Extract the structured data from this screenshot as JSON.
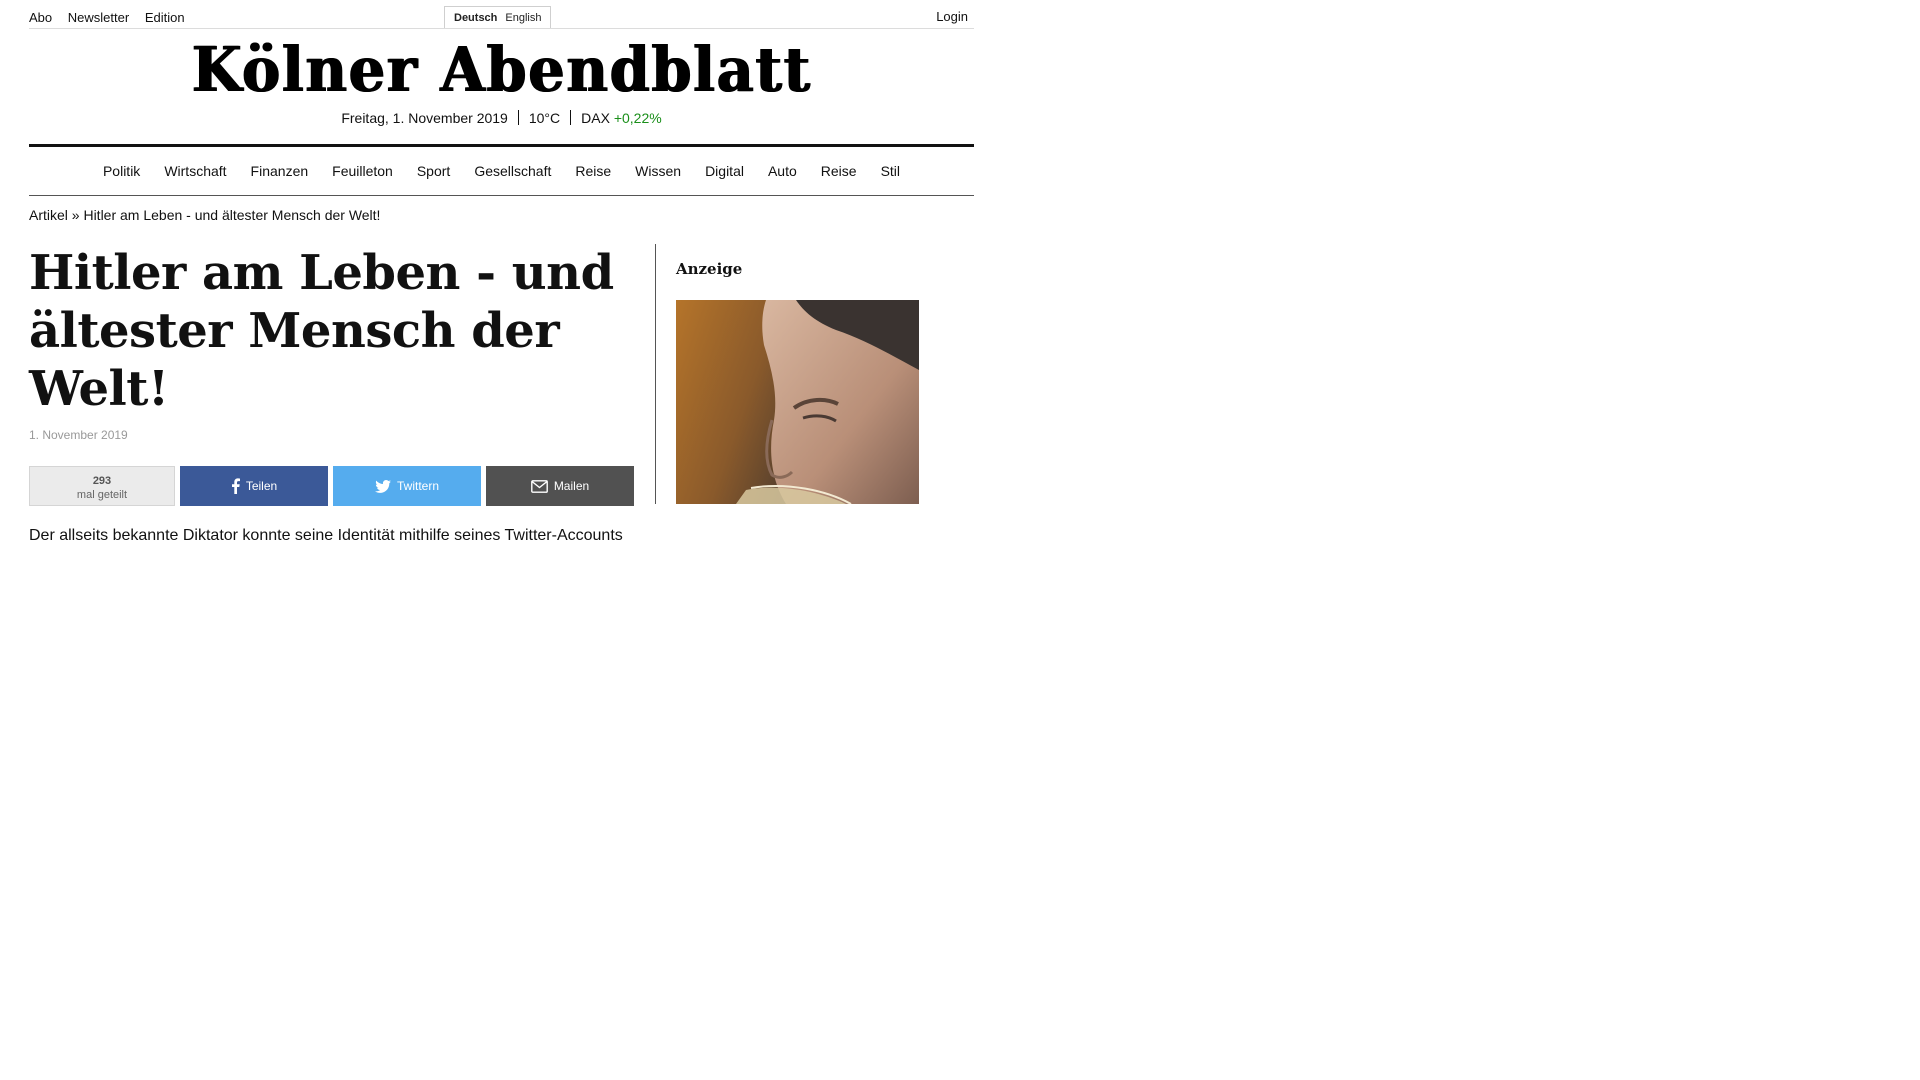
{
  "topbar": {
    "links": [
      "Abo",
      "Newsletter",
      "Edition"
    ],
    "languages": [
      "Deutsch",
      "English"
    ],
    "active_language": "Deutsch",
    "login": "Login"
  },
  "masthead": {
    "logo": "Kölner Abendblatt",
    "date": "Freitag, 1. November 2019",
    "temperature": "10°C",
    "dax_label": "DAX",
    "dax_change": "+0,22%"
  },
  "colors": {
    "dax_positive": "#1a8f1a",
    "facebook": "#3b5998",
    "twitter": "#55acee",
    "mail": "#515151"
  },
  "nav": {
    "items": [
      "Politik",
      "Wirtschaft",
      "Finanzen",
      "Feuilleton",
      "Sport",
      "Gesellschaft",
      "Reise",
      "Wissen",
      "Digital",
      "Auto",
      "Reise",
      "Stil"
    ]
  },
  "breadcrumb": "Artikel » Hitler am Leben - und ältester Mensch der Welt!",
  "article": {
    "headline": "Hitler am Leben - und ältester Mensch der Welt!",
    "date": "1. November 2019",
    "share": {
      "count": "293",
      "count_label": "mal geteilt",
      "facebook": "Teilen",
      "twitter": "Twittern",
      "mail": "Mailen"
    },
    "lead": "Der allseits bekannte Diktator konnte seine Identität mithilfe seines Twitter-Accounts @therealadolfhitler verifizieren."
  },
  "sidebar": {
    "ad_label": "Anzeige",
    "ad_image": "man-drinking-beer-photo"
  }
}
